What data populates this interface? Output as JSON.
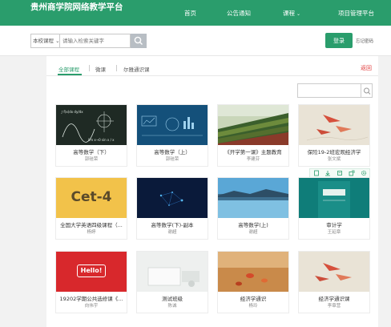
{
  "header": {
    "brand": "贵州商学院网络教学平台",
    "nav": {
      "home": "首页",
      "notice": "公告通知",
      "course": "课程",
      "project": "项目管理平台"
    }
  },
  "search": {
    "scope": "本校课程",
    "placeholder": "请输入检索关键字",
    "login": "登录",
    "forgot": "忘记密码"
  },
  "tabs": {
    "all": "全部课程",
    "micro": "微课",
    "er": "尔雅通识课",
    "back": "返回"
  },
  "courses": [
    {
      "title": "高等数学（下）",
      "teacher": "郭硅荣"
    },
    {
      "title": "高等数学（上）",
      "teacher": "郭硅荣"
    },
    {
      "title": "《开学第一课》主题教育",
      "teacher": "李建芬"
    },
    {
      "title": "保险19-2班宏观经济学",
      "teacher": "张文斌"
    },
    {
      "title": "全国大学英语四级课程（...",
      "teacher": "杨婷"
    },
    {
      "title": "高等数学(下)-副本",
      "teacher": "谢超"
    },
    {
      "title": "高等数学(上)",
      "teacher": "谢超"
    },
    {
      "title": "审计学",
      "teacher": "王延章"
    },
    {
      "title": "19202学期公共选修课《...",
      "teacher": "向伟宇"
    },
    {
      "title": "测试班级",
      "teacher": "陈诚"
    },
    {
      "title": "经济学通识",
      "teacher": "杨玲"
    },
    {
      "title": "经济学通识课",
      "teacher": "李章营"
    }
  ],
  "thumb_text": {
    "cet": "Cet-4",
    "hello": "Hello!"
  },
  "colors": {
    "brand_green": "#2a9d6c",
    "back_red": "#e03a3a"
  }
}
